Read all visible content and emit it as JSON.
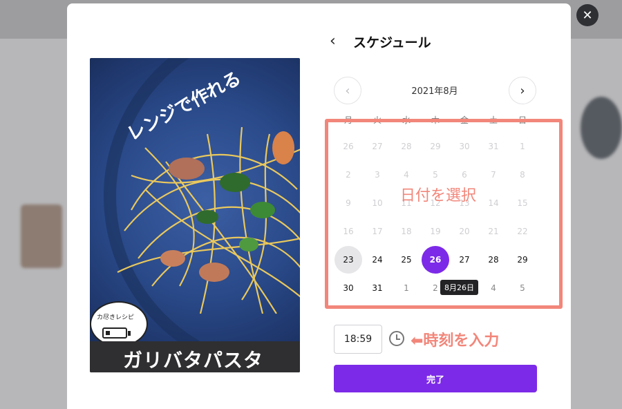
{
  "schedule": {
    "title": "スケジュール",
    "back_icon": "chevron-left-icon",
    "month_label": "2021年8月",
    "weekdays": [
      "月",
      "火",
      "水",
      "木",
      "金",
      "土",
      "日"
    ],
    "weeks": [
      [
        "26",
        "27",
        "28",
        "29",
        "30",
        "31",
        "1"
      ],
      [
        "2",
        "3",
        "4",
        "5",
        "6",
        "7",
        "8"
      ],
      [
        "9",
        "10",
        "11",
        "12",
        "13",
        "14",
        "15"
      ],
      [
        "16",
        "17",
        "18",
        "19",
        "20",
        "21",
        "22"
      ],
      [
        "23",
        "24",
        "25",
        "26",
        "27",
        "28",
        "29"
      ],
      [
        "30",
        "31",
        "1",
        "2",
        "3",
        "4",
        "5"
      ]
    ],
    "today": "23",
    "selected": "26",
    "tooltip": "8月26日",
    "time_value": "18:59",
    "done_label": "完了"
  },
  "annotations": {
    "date_hint": "日付を選択",
    "time_hint": "⬅時刻を入力",
    "highlight_color": "#f2867a"
  },
  "preview": {
    "top_caption": "レンジで作れる",
    "bubble_text": "カ尽きレシピ",
    "title": "ガリバタパスタ"
  },
  "colors": {
    "accent": "#7c2ae8",
    "annotation": "#f2867a"
  }
}
